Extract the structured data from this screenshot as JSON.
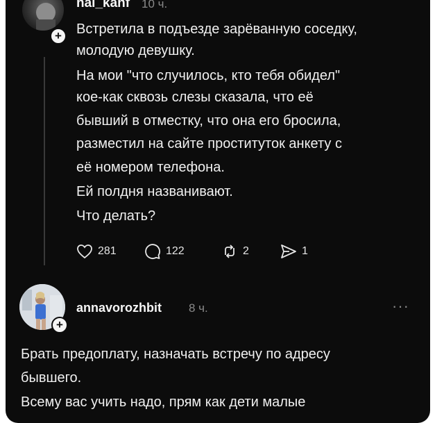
{
  "post": {
    "username": "nai_kanf",
    "time": "10 ч.",
    "lines": [
      "Встретила в подъезде зарёванную соседку,",
      "молодую девушку.",
      "На мои \"что случилось, кто тебя обидел\"",
      "кое-как сквозь слезы сказала, что её",
      "бывший в отместку, что она его бросила,",
      "разместил на сайте проституток анкету с",
      "её номером телефона.",
      "Ей полдня названивают.",
      "Что делать?"
    ],
    "stats": {
      "likes": "281",
      "comments": "122",
      "reposts": "2",
      "shares": "1"
    }
  },
  "reply": {
    "username": "annavorozhbit",
    "time": "8 ч.",
    "more": "···",
    "lines": [
      "Брать предоплату, назначать встречу по адресу",
      "бывшего.",
      "Всему вас учить надо, прям как дети малые"
    ]
  },
  "icons": {
    "follow_badge": "+",
    "like": "heart-icon",
    "comment": "comment-icon",
    "repost": "repost-icon",
    "share": "share-icon"
  }
}
